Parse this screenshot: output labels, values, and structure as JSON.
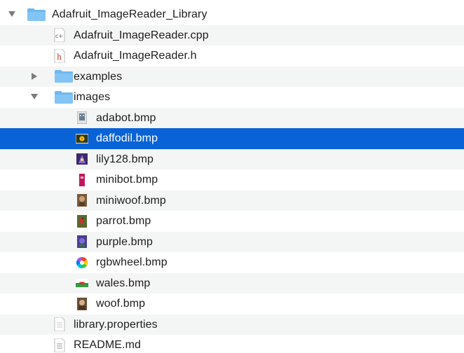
{
  "tree": {
    "root": {
      "label": "Adafruit_ImageReader_Library",
      "icon": "folder-icon",
      "expanded": true
    },
    "items": [
      {
        "label": "Adafruit_ImageReader.cpp",
        "icon": "cpp-file-icon"
      },
      {
        "label": "Adafruit_ImageReader.h",
        "icon": "h-file-icon"
      },
      {
        "label": "examples",
        "icon": "folder-icon",
        "expanded": false
      },
      {
        "label": "images",
        "icon": "folder-icon",
        "expanded": true
      },
      {
        "label": "adabot.bmp",
        "icon": "bmp-thumbnail-icon"
      },
      {
        "label": "daffodil.bmp",
        "icon": "bmp-thumbnail-icon",
        "selected": true
      },
      {
        "label": "lily128.bmp",
        "icon": "bmp-thumbnail-icon"
      },
      {
        "label": "minibot.bmp",
        "icon": "bmp-thumbnail-icon"
      },
      {
        "label": "miniwoof.bmp",
        "icon": "bmp-thumbnail-icon"
      },
      {
        "label": "parrot.bmp",
        "icon": "bmp-thumbnail-icon"
      },
      {
        "label": "purple.bmp",
        "icon": "bmp-thumbnail-icon"
      },
      {
        "label": "rgbwheel.bmp",
        "icon": "bmp-thumbnail-icon"
      },
      {
        "label": "wales.bmp",
        "icon": "bmp-thumbnail-icon"
      },
      {
        "label": "woof.bmp",
        "icon": "bmp-thumbnail-icon"
      },
      {
        "label": "library.properties",
        "icon": "text-file-icon"
      },
      {
        "label": "README.md",
        "icon": "text-file-icon"
      }
    ]
  },
  "colors": {
    "folder": "#6fb8f0",
    "selection": "#0963d6",
    "stripe": "#f4f5f5"
  }
}
